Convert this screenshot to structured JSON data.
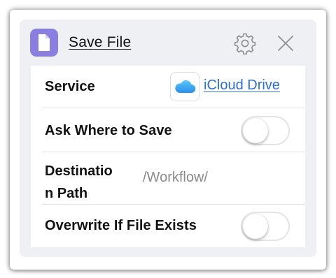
{
  "action": {
    "title": "Save File",
    "icon": "document-icon",
    "accent_color": "#8a7ee0"
  },
  "header_buttons": {
    "settings_icon": "gear-icon",
    "close_icon": "close-icon"
  },
  "fields": {
    "service": {
      "label": "Service",
      "value": "iCloud Drive",
      "icon": "icloud-icon",
      "link_color": "#2d6fd4"
    },
    "ask_where_to_save": {
      "label": "Ask Where to Save",
      "enabled": false
    },
    "destination_path": {
      "label_line1": "Destinatio",
      "label_line2": "n Path",
      "value": "/Workflow/"
    },
    "overwrite_if_exists": {
      "label": "Overwrite If File Exists",
      "enabled": false
    }
  }
}
